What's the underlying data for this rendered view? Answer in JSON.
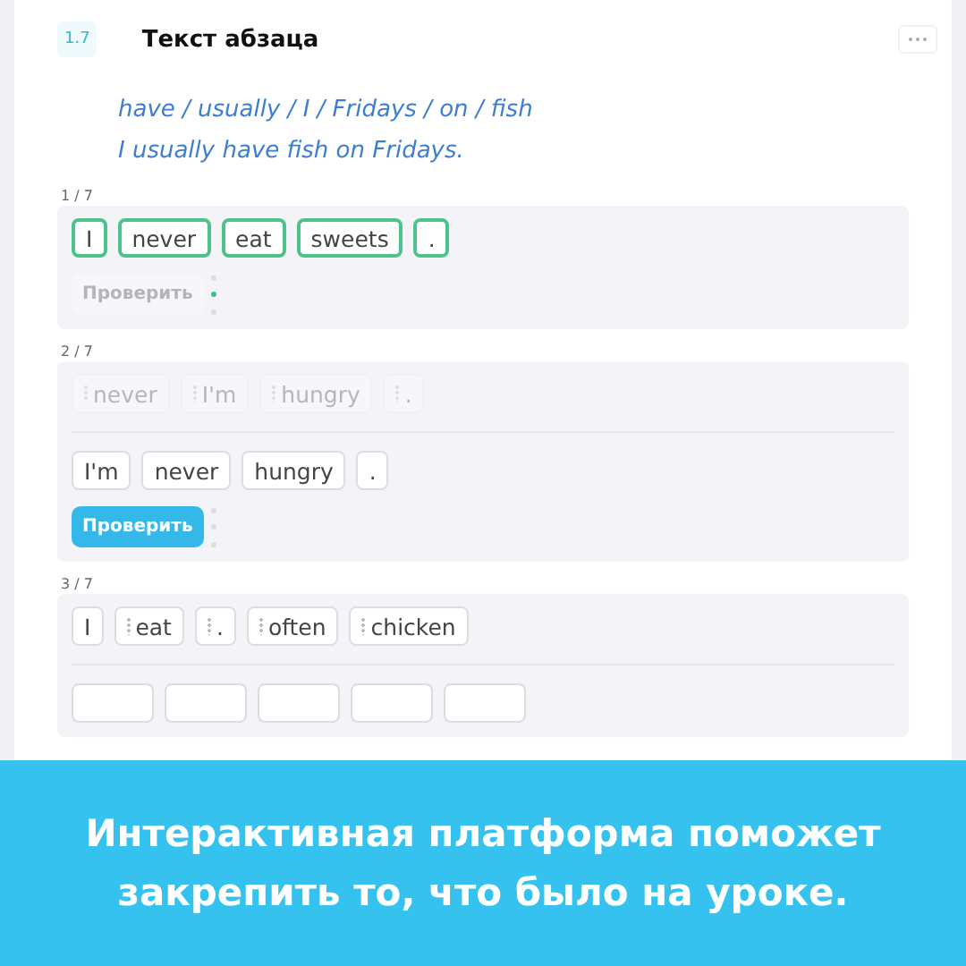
{
  "header": {
    "number": "1.7",
    "title": "Текст абзаца"
  },
  "example": [
    "have / usually / I / Fridays / on / fish",
    "I usually have fish on Fridays."
  ],
  "tasks": [
    {
      "counter": "1 / 7",
      "answer": [
        {
          "kind": "word",
          "text": "I",
          "correct": true
        },
        {
          "kind": "word",
          "text": "never",
          "correct": true
        },
        {
          "kind": "word",
          "text": "eat",
          "correct": true
        },
        {
          "kind": "word",
          "text": "sweets",
          "correct": true
        },
        {
          "kind": "word",
          "text": ".",
          "correct": true
        }
      ],
      "button": {
        "label": "Проверить",
        "disabled": true
      }
    },
    {
      "counter": "2 / 7",
      "bank": [
        {
          "text": "never",
          "used": true,
          "handle": true
        },
        {
          "text": "I'm",
          "used": true,
          "handle": true
        },
        {
          "text": "hungry",
          "used": true,
          "handle": true
        },
        {
          "text": ".",
          "used": true,
          "handle": true
        }
      ],
      "answer": [
        {
          "kind": "word",
          "text": "I'm",
          "correct": false
        },
        {
          "kind": "word",
          "text": "never",
          "correct": false
        },
        {
          "kind": "word",
          "text": "hungry",
          "correct": false
        },
        {
          "kind": "word",
          "text": ".",
          "correct": false
        }
      ],
      "button": {
        "label": "Проверить",
        "disabled": false
      }
    },
    {
      "counter": "3 / 7",
      "bank": [
        {
          "text": "I",
          "used": false,
          "handle": false
        },
        {
          "text": "eat",
          "used": false,
          "handle": true
        },
        {
          "text": ".",
          "used": false,
          "handle": true
        },
        {
          "text": "often",
          "used": false,
          "handle": true
        },
        {
          "text": "chicken",
          "used": false,
          "handle": true
        }
      ],
      "answer": [
        {
          "kind": "slot"
        },
        {
          "kind": "slot"
        },
        {
          "kind": "slot"
        },
        {
          "kind": "slot"
        },
        {
          "kind": "slot"
        }
      ]
    }
  ],
  "banner": "Интерактивная платформа поможет закрепить то, что было на уроке."
}
